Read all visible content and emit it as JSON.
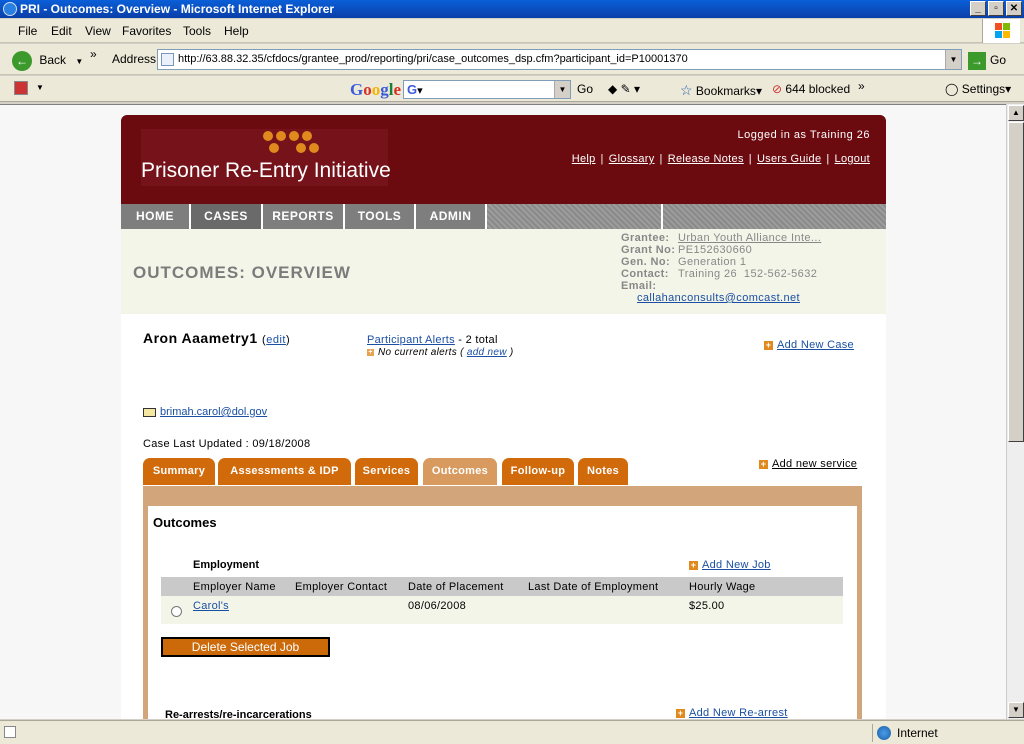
{
  "window": {
    "title": "PRI - Outcomes: Overview - Microsoft Internet Explorer"
  },
  "menu": [
    "File",
    "Edit",
    "View",
    "Favorites",
    "Tools",
    "Help"
  ],
  "toolbar": {
    "back_label": "Back",
    "address_label": "Address",
    "url": "http://63.88.32.35/cfdocs/grantee_prod/reporting/pri/case_outcomes_dsp.cfm?participant_id=P10001370",
    "go_label": "Go"
  },
  "googlebar": {
    "logo": "Google",
    "go_label": "Go",
    "bookmarks_label": "Bookmarks",
    "blocked_label": "644 blocked",
    "settings_label": "Settings"
  },
  "status": {
    "zone": "Internet"
  },
  "site": {
    "logo_text": "Prisoner Re-Entry Initiative",
    "logged_in": "Logged in as Training 26",
    "header_links": [
      "Help",
      "Glossary",
      "Release Notes",
      "Users Guide",
      "Logout"
    ],
    "nav": [
      "HOME",
      "CASES",
      "REPORTS",
      "TOOLS",
      "ADMIN"
    ],
    "active_nav": "CASES"
  },
  "info": {
    "page_title": "OUTCOMES: OVERVIEW",
    "grantee_label": "Grantee:",
    "grantee": "Urban Youth Alliance Inte...",
    "grant_no_label": "Grant No:",
    "grant_no": "PE152630660",
    "gen_no_label": "Gen. No:",
    "gen_no": "Generation 1",
    "contact_label": "Contact:",
    "contact": "Training 26  152-562-5632",
    "email_label": "Email:",
    "email": "callahanconsults@comcast.net"
  },
  "participant": {
    "name": "Aron Aaametry1",
    "edit_open": "(",
    "edit": "edit",
    "edit_close": ")",
    "alerts_link": "Participant Alerts",
    "alerts_total": "- 2 total",
    "no_alerts": "No current alerts (",
    "add_new": "add new",
    "no_alerts_close": ")",
    "add_case": "Add New Case",
    "email": "brimah.carol@dol.gov",
    "last_updated": "Case Last Updated : 09/18/2008"
  },
  "tabs": [
    "Summary",
    "Assessments & IDP",
    "Services",
    "Outcomes",
    "Follow-up",
    "Notes"
  ],
  "active_tab": "Outcomes",
  "add_service": "Add new service",
  "outcomes": {
    "title": "Outcomes",
    "employment_title": "Employment",
    "add_job": "Add New Job",
    "columns": [
      "Employer Name",
      "Employer Contact",
      "Date of Placement",
      "Last Date of Employment",
      "Hourly Wage"
    ],
    "rows": [
      {
        "employer": "Carol's",
        "contact": "",
        "placement": "08/06/2008",
        "last_date": "",
        "wage": "$25.00"
      }
    ],
    "delete_button": "Delete Selected Job",
    "rearrests_title": "Re-arrests/re-incarcerations",
    "add_rearrest": "Add New Re-arrest"
  }
}
